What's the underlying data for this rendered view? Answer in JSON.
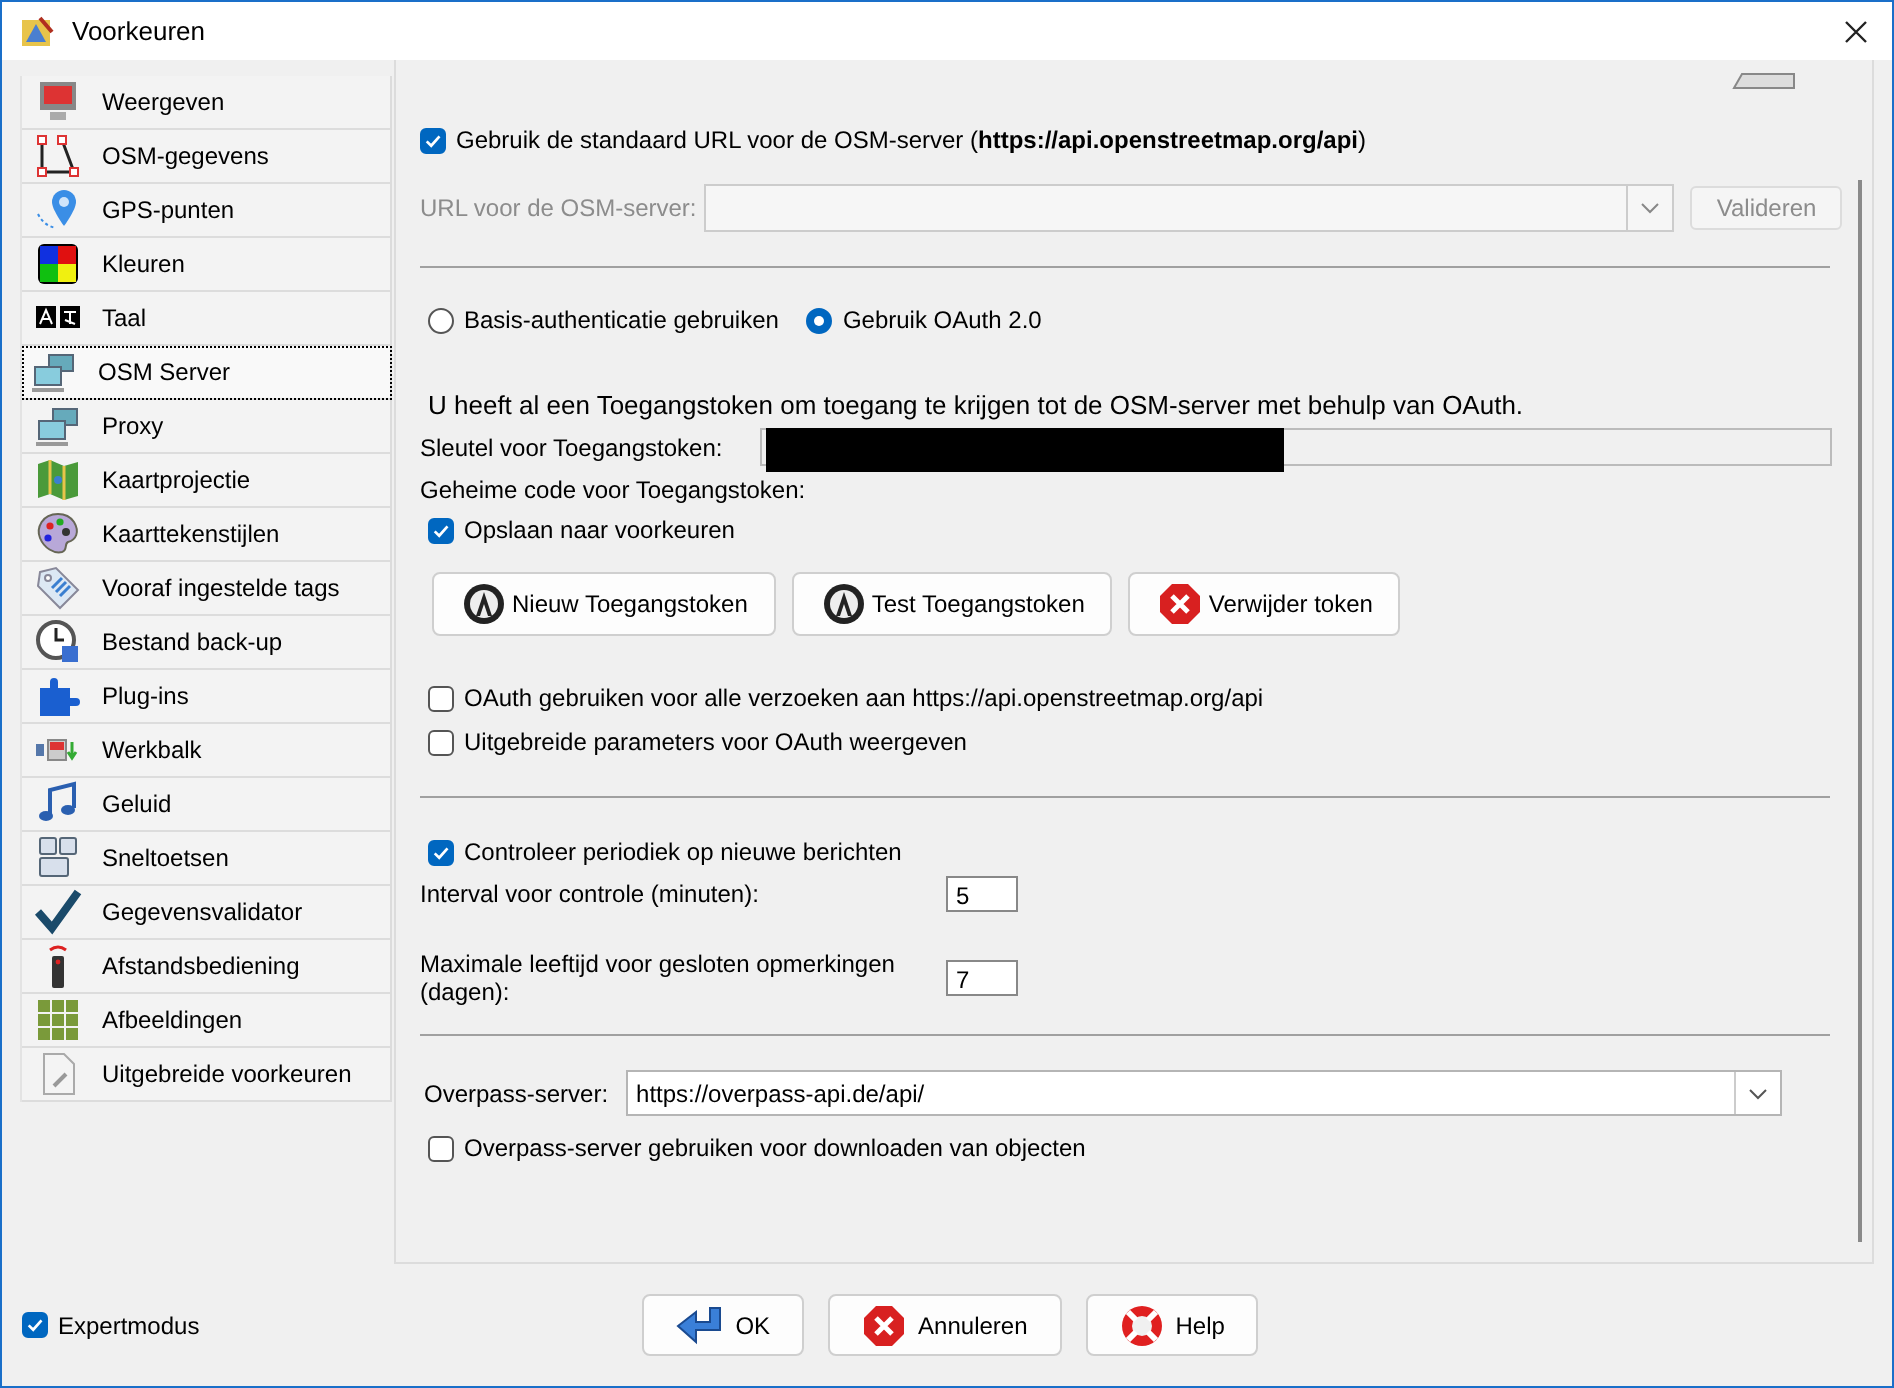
{
  "window": {
    "title": "Voorkeuren"
  },
  "sidebar": {
    "items": [
      {
        "label": "Weergeven",
        "selected": false
      },
      {
        "label": "OSM-gegevens",
        "selected": false
      },
      {
        "label": "GPS-punten",
        "selected": false
      },
      {
        "label": "Kleuren",
        "selected": false
      },
      {
        "label": "Taal",
        "selected": false
      },
      {
        "label": "OSM Server",
        "selected": true
      },
      {
        "label": "Proxy",
        "selected": false
      },
      {
        "label": "Kaartprojectie",
        "selected": false
      },
      {
        "label": "Kaarttekenstijlen",
        "selected": false
      },
      {
        "label": "Vooraf ingestelde tags",
        "selected": false
      },
      {
        "label": "Bestand back-up",
        "selected": false
      },
      {
        "label": "Plug-ins",
        "selected": false
      },
      {
        "label": "Werkbalk",
        "selected": false
      },
      {
        "label": "Geluid",
        "selected": false
      },
      {
        "label": "Sneltoetsen",
        "selected": false
      },
      {
        "label": "Gegevensvalidator",
        "selected": false
      },
      {
        "label": "Afstandsbediening",
        "selected": false
      },
      {
        "label": "Afbeeldingen",
        "selected": false
      },
      {
        "label": "Uitgebreide voorkeuren",
        "selected": false
      }
    ]
  },
  "server": {
    "use_default": {
      "label": "Gebruik de standaard URL voor de OSM-server (**https://api.openstreetmap.org/api**)",
      "checked": true
    },
    "url": {
      "label": "URL voor de OSM-server:",
      "disabled": true
    },
    "validate_button": {
      "label": "Valideren",
      "disabled": true
    },
    "auth_options": [
      {
        "label": "Basis-authenticatie gebruiken",
        "selected": false
      },
      {
        "label": "Gebruik OAuth 2.0",
        "selected": true
      }
    ],
    "info": "U heeft al een Toegangstoken om toegang te krijgen tot de OSM-server met behulp van OAuth.",
    "token_key_label": "Sleutel voor Toegangstoken:",
    "token_secret_label": "Geheime code voor Toegangstoken:",
    "save": {
      "label": "Opslaan naar voorkeuren",
      "checked": true
    },
    "token_buttons": [
      {
        "label": "Nieuw Toegangstoken",
        "kind": "oauth"
      },
      {
        "label": "Test Toegangstoken",
        "kind": "oauth"
      },
      {
        "label": "Verwijder token",
        "kind": "remove"
      }
    ],
    "oauth_options": [
      {
        "label": "OAuth gebruiken voor alle verzoeken aan https://api.openstreetmap.org/api",
        "checked": false
      },
      {
        "label": "Uitgebreide parameters voor OAuth weergeven",
        "checked": false
      }
    ],
    "notes_check": {
      "label": "Controleer periodiek op nieuwe berichten",
      "checked": true
    },
    "notes_fields": [
      {
        "label": "Interval voor controle (minuten):",
        "value": "5"
      },
      {
        "label": "Maximale leeftijd voor gesloten opmerkingen (dagen):",
        "value": "7"
      }
    ],
    "overpass": {
      "label": "Overpass-server:",
      "value": "https://overpass-api.de/api/"
    },
    "overpass_option": {
      "label": "Overpass-server gebruiken voor downloaden van objecten",
      "checked": false
    }
  },
  "expert_mode": {
    "label": "Expertmodus",
    "checked": true
  },
  "buttons": [
    {
      "label": "OK",
      "kind": "ok"
    },
    {
      "label": "Annuleren",
      "kind": "cancel"
    },
    {
      "label": "Help",
      "kind": "help"
    }
  ]
}
